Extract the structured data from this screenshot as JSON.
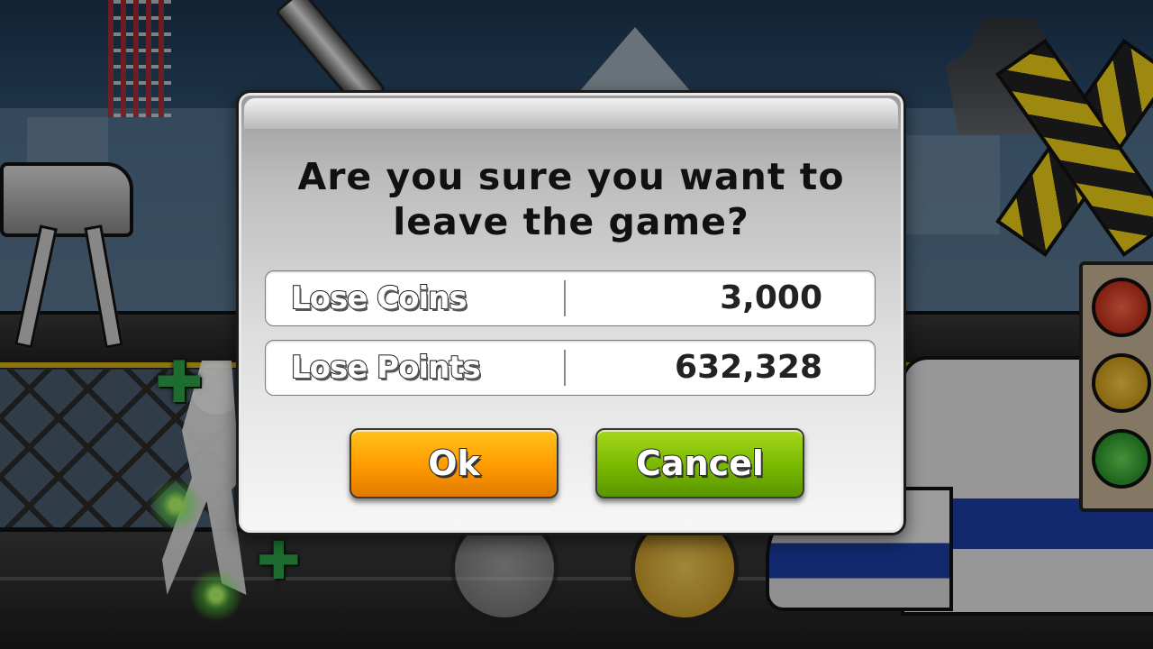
{
  "dialog": {
    "title_line1": "Are you sure you want to",
    "title_line2": "leave the game?",
    "rows": [
      {
        "label": "Lose Coins",
        "value": "3,000"
      },
      {
        "label": "Lose Points",
        "value": "632,328"
      }
    ],
    "ok_label": "Ok",
    "cancel_label": "Cancel"
  },
  "colors": {
    "ok_button": "#ff9a00",
    "cancel_button": "#78b800"
  }
}
